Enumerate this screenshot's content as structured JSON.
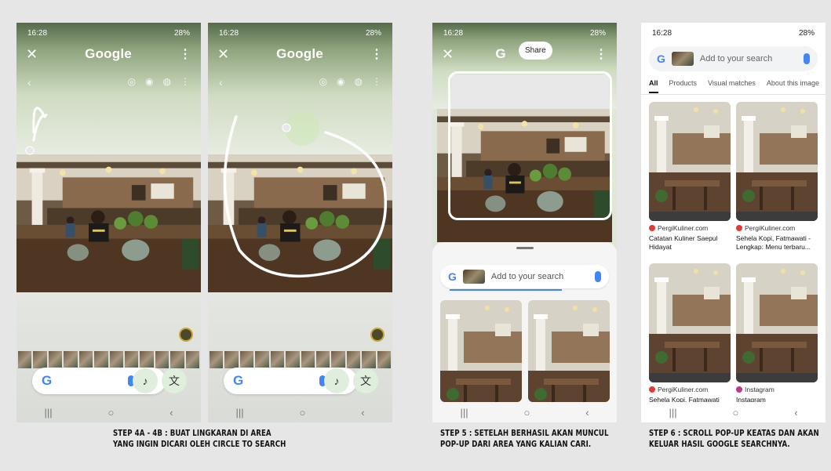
{
  "status": {
    "time": "16:28",
    "battery": "28%"
  },
  "app": {
    "title": "Google",
    "share_label": "Share"
  },
  "search": {
    "placeholder": "Add to your search",
    "logo": "G"
  },
  "tabs": [
    {
      "label": "All"
    },
    {
      "label": "Products"
    },
    {
      "label": "Visual matches"
    },
    {
      "label": "About this image"
    }
  ],
  "results": [
    {
      "source": "PergiKuliner.com",
      "title_line1": "Catatan Kuliner Saepul",
      "title_line2": "Hidayat",
      "source_icon": "pergikuliner-icon"
    },
    {
      "source": "PergiKuliner.com",
      "title_line1": "Sehela Kopi, Fatmawati -",
      "title_line2": "Lengkap: Menu terbaru...",
      "source_icon": "pergikuliner-icon"
    },
    {
      "source": "PergiKuliner.com",
      "title_line1": "Sehela Kopi, Fatmawati",
      "title_line2": "",
      "source_icon": "pergikuliner-icon"
    },
    {
      "source": "Instagram",
      "title_line1": "Instagram",
      "title_line2": "",
      "source_icon": "instagram-icon"
    }
  ],
  "captions": {
    "step4_line1": "STEP 4A - 4B : BUAT LINGKARAN DI AREA",
    "step4_line2": "YANG INGIN DICARI OLEH CIRCLE TO SEARCH",
    "step5_line1": "STEP 5 : SETELAH BERHASIL AKAN MUNCUL",
    "step5_line2": "POP-UP DARI AREA YANG KALIAN CARI.",
    "step6_line1": "STEP 6 : SCROLL POP-UP KEATAS DAN AKAN",
    "step6_line2": "KELUAR HASIL GOOGLE SEARCHNYA."
  },
  "icons": {
    "close": "close-icon",
    "more": "more-vert-icon",
    "mic": "mic-icon",
    "lens": "lens-icon",
    "music": "music-note-icon",
    "translate": "translate-icon",
    "nav_recents": "recents-icon",
    "nav_home": "home-icon",
    "nav_back": "back-icon"
  },
  "colors": {
    "google_blue": "#4285f4",
    "google_red": "#ea4335",
    "google_yellow": "#fbbc05",
    "google_green": "#34a853",
    "accent_green_button": "#dfeedd"
  }
}
